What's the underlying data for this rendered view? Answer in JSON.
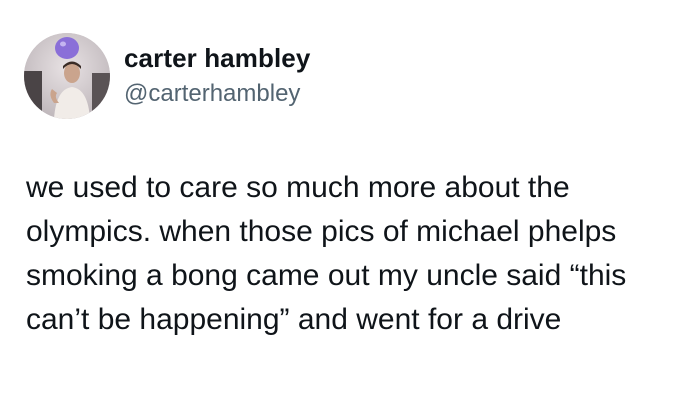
{
  "author": {
    "display_name": "carter hambley",
    "handle": "@carterhambley"
  },
  "tweet": {
    "lines": [
      "we used to care so much more about the",
      "olympics. when those pics of michael phelps",
      "smoking a bong came out my uncle said “this",
      "can’t be happening” and went for a drive"
    ]
  },
  "colors": {
    "text": "#0f1419",
    "secondary_text": "#536471",
    "background": "#ffffff",
    "avatar_balloon": "#8a6fd8"
  }
}
